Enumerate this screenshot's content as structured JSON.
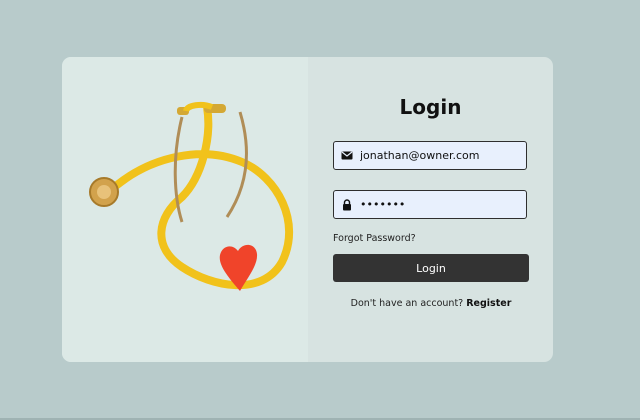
{
  "colors": {
    "background": "#b8cbcb",
    "card": "#d7e3e1",
    "button": "#333333",
    "input_bg": "#e8f0fd"
  },
  "illustration": {
    "alt": "stethoscope-heart-image"
  },
  "form": {
    "title": "Login",
    "email": {
      "icon": "envelope-icon",
      "value": "jonathan@owner.com"
    },
    "password": {
      "icon": "lock-icon",
      "value": "•••••••"
    },
    "forgot_label": "Forgot Password?",
    "login_label": "Login",
    "register_prompt": "Don't have an account?",
    "register_link": "Register"
  }
}
